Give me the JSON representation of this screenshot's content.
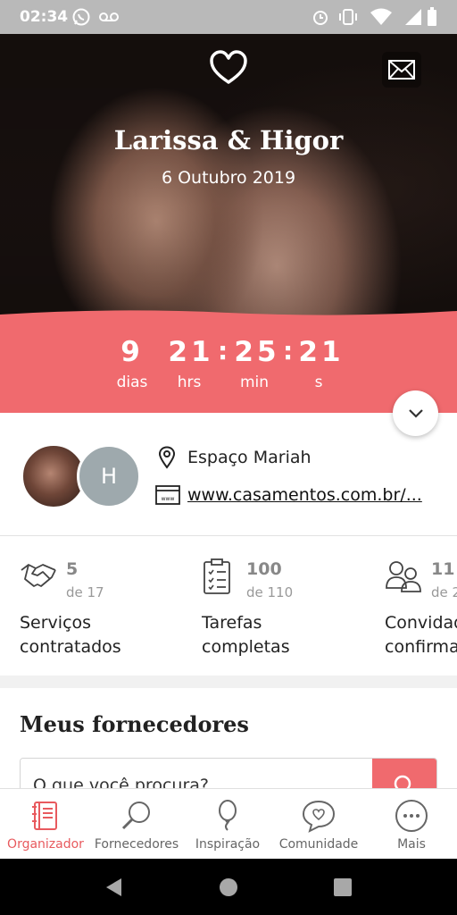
{
  "status_bar": {
    "time": "02:34",
    "icons": [
      "whatsapp-icon",
      "voicemail-icon",
      "alarm-icon",
      "vibrate-icon",
      "wifi-icon",
      "signal-icon",
      "battery-icon"
    ]
  },
  "hero": {
    "couple_names": "Larissa & Higor",
    "wedding_date": "6 Outubro 2019",
    "icons": [
      "heart-logo-icon",
      "mail-icon"
    ]
  },
  "countdown": {
    "days": "9",
    "days_label": "dias",
    "hours": "21",
    "hours_label": "hrs",
    "minutes": "25",
    "minutes_label": "min",
    "seconds": "21",
    "seconds_label": "s",
    "separator": ":"
  },
  "info": {
    "avatar_initial": "H",
    "venue": "Espaço Mariah",
    "website": "www.casamentos.com.br/..."
  },
  "stats": [
    {
      "count": "5",
      "total": "de 17",
      "label_line1": "Serviços",
      "label_line2": "contratados",
      "icon": "handshake-icon"
    },
    {
      "count": "100",
      "total": "de 110",
      "label_line1": "Tarefas",
      "label_line2": "completas",
      "icon": "checklist-icon"
    },
    {
      "count": "11",
      "total": "de 2",
      "label_line1": "Convidad",
      "label_line2": "confirma",
      "icon": "guests-icon"
    }
  ],
  "suppliers": {
    "title": "Meus fornecedores",
    "search_placeholder": "O que você procura?"
  },
  "bottom_nav": [
    {
      "label": "Organizador",
      "icon": "notebook-icon",
      "active": true
    },
    {
      "label": "Fornecedores",
      "icon": "search-icon",
      "active": false
    },
    {
      "label": "Inspiração",
      "icon": "balloon-icon",
      "active": false
    },
    {
      "label": "Comunidade",
      "icon": "chat-heart-icon",
      "active": false
    },
    {
      "label": "Mais",
      "icon": "more-icon",
      "active": false
    }
  ],
  "colors": {
    "accent": "#f06a6e",
    "active_nav": "#e85a5e"
  }
}
